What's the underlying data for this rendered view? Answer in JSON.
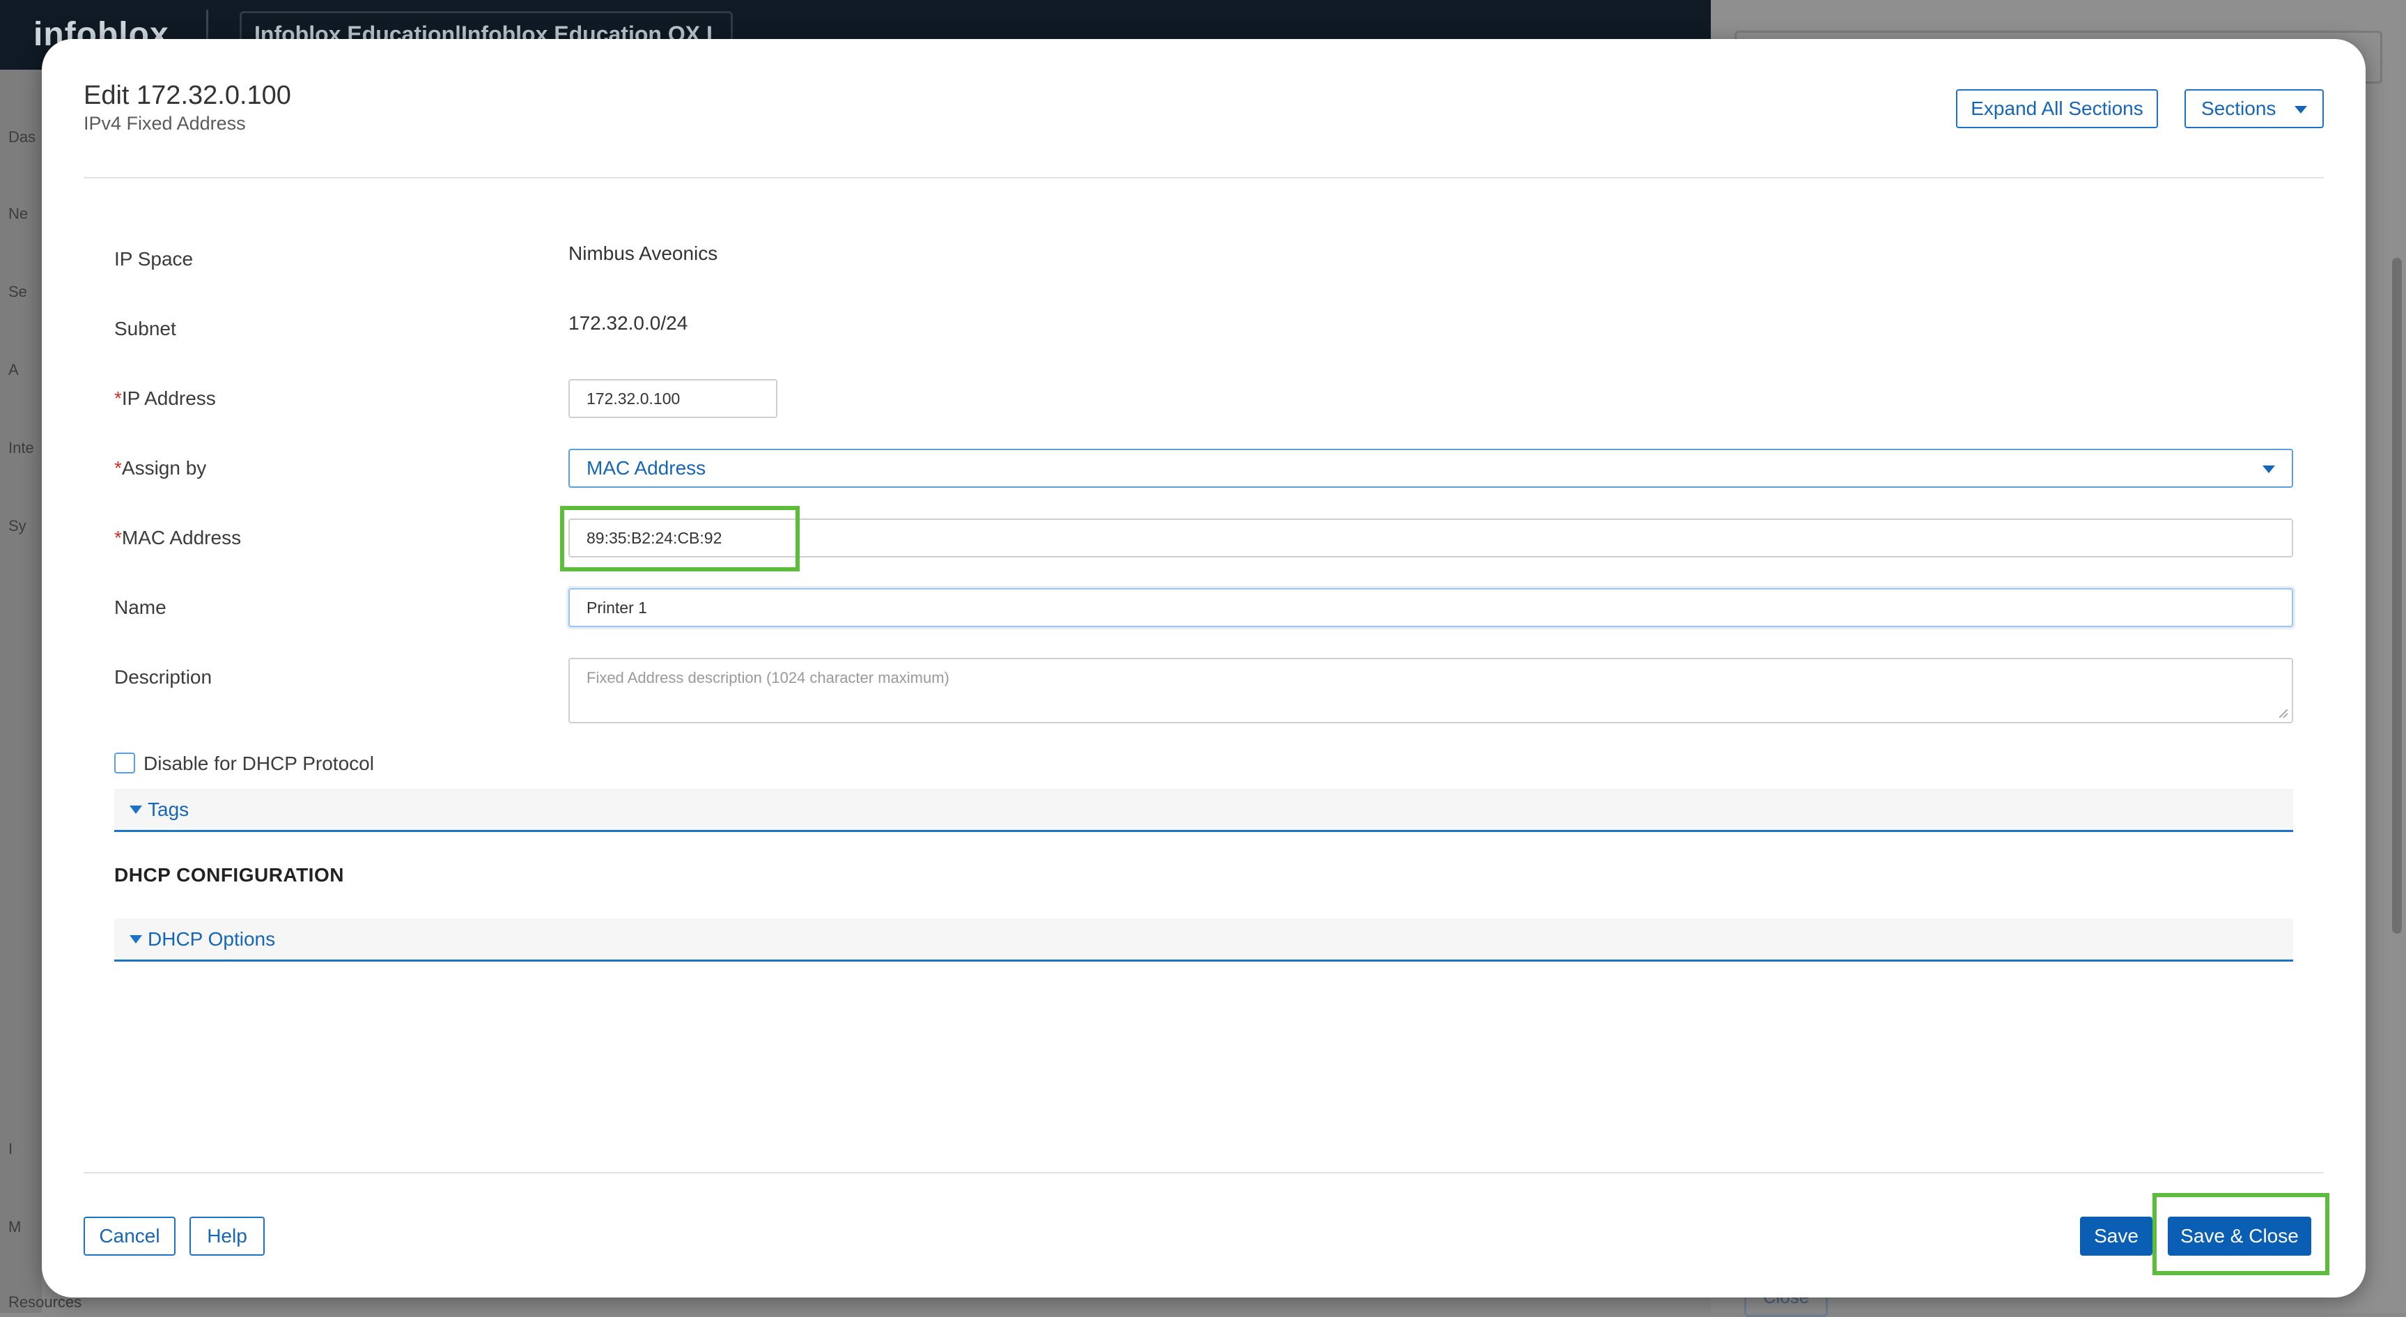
{
  "app": {
    "logo": "infoblox",
    "account_selector": "Infoblox Education|Infoblox Education OX L",
    "sidebar_items": [
      "Das",
      "Ne",
      "Se",
      "A",
      "Inte",
      "Sy",
      "I",
      "M",
      "Resources"
    ],
    "right_panel_close": "Close"
  },
  "modal": {
    "title": "Edit 172.32.0.100",
    "subtitle": "IPv4 Fixed Address",
    "expand_all_label": "Expand All Sections",
    "sections_label": "Sections"
  },
  "form": {
    "ip_space": {
      "label": "IP Space",
      "value": "Nimbus Aveonics"
    },
    "subnet": {
      "label": "Subnet",
      "value": "172.32.0.0/24"
    },
    "ip_address": {
      "required": "*",
      "label": "IP Address",
      "value": "172.32.0.100"
    },
    "assign_by": {
      "required": "*",
      "label": "Assign by",
      "value": "MAC Address"
    },
    "mac_address": {
      "required": "*",
      "label": "MAC Address",
      "value": "89:35:B2:24:CB:92"
    },
    "name": {
      "label": "Name",
      "value": "Printer 1"
    },
    "description": {
      "label": "Description",
      "placeholder": "Fixed Address description (1024 character maximum)"
    },
    "disable_dhcp": {
      "label": "Disable for DHCP Protocol",
      "checked": false
    },
    "tags_section": "Tags",
    "dhcp_heading": "DHCP CONFIGURATION",
    "dhcp_options_section": "DHCP Options"
  },
  "footer": {
    "cancel_label": "Cancel",
    "help_label": "Help",
    "save_label": "Save",
    "save_close_label": "Save & Close"
  },
  "colors": {
    "accent": "#1a73c9",
    "primary_button": "#0a5fb4",
    "highlight_box": "#5cbc3c",
    "required": "#d0312d"
  }
}
